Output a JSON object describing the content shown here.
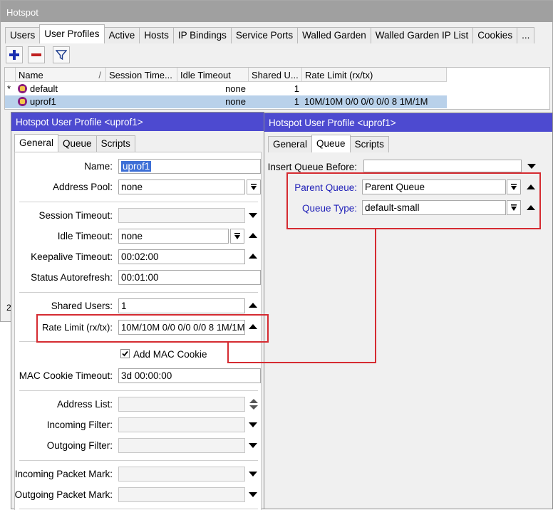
{
  "main": {
    "title": "Hotspot",
    "tabs": [
      "Users",
      "User Profiles",
      "Active",
      "Hosts",
      "IP Bindings",
      "Service Ports",
      "Walled Garden",
      "Walled Garden IP List",
      "Cookies",
      "..."
    ],
    "active_tab": "User Profiles",
    "toolbar": {
      "add_icon": "plus-icon",
      "remove_icon": "minus-icon",
      "filter_icon": "filter-icon"
    },
    "table": {
      "columns": [
        "Name",
        "Session Time...",
        "Idle Timeout",
        "Shared U...",
        "Rate Limit (rx/tx)"
      ],
      "sort_marker": "/",
      "rows": [
        {
          "marker": "*",
          "name": "default",
          "session_timeout": "",
          "idle_timeout": "none",
          "shared_users": "1",
          "rate_limit": ""
        },
        {
          "marker": "",
          "name": "uprof1",
          "session_timeout": "",
          "idle_timeout": "none",
          "shared_users": "1",
          "rate_limit": "10M/10M 0/0 0/0 0/0 8 1M/1M"
        }
      ],
      "footer_peek": "2"
    }
  },
  "left_dialog": {
    "title": "Hotspot User Profile <uprof1>",
    "tabs": [
      "General",
      "Queue",
      "Scripts"
    ],
    "active_tab": "General",
    "fields": {
      "name": {
        "label": "Name:",
        "value": "uprof1"
      },
      "address_pool": {
        "label": "Address Pool:",
        "value": "none"
      },
      "session_timeout": {
        "label": "Session Timeout:",
        "value": ""
      },
      "idle_timeout": {
        "label": "Idle Timeout:",
        "value": "none"
      },
      "keepalive_timeout": {
        "label": "Keepalive Timeout:",
        "value": "00:02:00"
      },
      "status_autorefresh": {
        "label": "Status Autorefresh:",
        "value": "00:01:00"
      },
      "shared_users": {
        "label": "Shared Users:",
        "value": "1"
      },
      "rate_limit": {
        "label": "Rate Limit (rx/tx):",
        "value": "10M/10M 0/0 0/0 0/0 8 1M/1M"
      },
      "add_mac_cookie": {
        "label": "Add MAC Cookie",
        "checked": true
      },
      "mac_cookie_timeout": {
        "label": "MAC Cookie Timeout:",
        "value": "3d 00:00:00"
      },
      "address_list": {
        "label": "Address List:",
        "value": ""
      },
      "incoming_filter": {
        "label": "Incoming Filter:",
        "value": ""
      },
      "outgoing_filter": {
        "label": "Outgoing Filter:",
        "value": ""
      },
      "incoming_packet_mark": {
        "label": "Incoming Packet Mark:",
        "value": ""
      },
      "outgoing_packet_mark": {
        "label": "Outgoing Packet Mark:",
        "value": ""
      }
    }
  },
  "right_dialog": {
    "title": "Hotspot User Profile <uprof1>",
    "tabs": [
      "General",
      "Queue",
      "Scripts"
    ],
    "active_tab": "Queue",
    "fields": {
      "insert_queue_before": {
        "label": "Insert Queue Before:",
        "value": ""
      },
      "parent_queue": {
        "label": "Parent Queue:",
        "value": "Parent Queue"
      },
      "queue_type": {
        "label": "Queue Type:",
        "value": "default-small"
      }
    }
  },
  "colors": {
    "title_active": "#4d4ad0",
    "title_inactive": "#a0a0a0",
    "highlight": "#d52b31",
    "selection": "#b9d1ea",
    "blue_label": "#2020b8"
  }
}
